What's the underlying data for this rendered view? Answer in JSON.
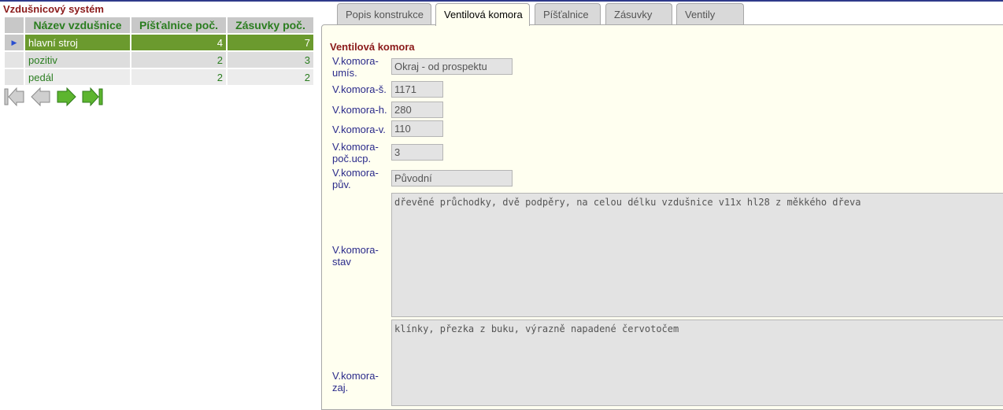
{
  "left": {
    "title": "Vzdušnicový systém",
    "columns": [
      "Název vzdušnice",
      "Píšťalnice poč.",
      "Zásuvky poč."
    ],
    "rows": [
      {
        "name": "hlavní stroj",
        "pist": "4",
        "zas": "7",
        "selected": true
      },
      {
        "name": "pozitiv",
        "pist": "2",
        "zas": "3"
      },
      {
        "name": "pedál",
        "pist": "2",
        "zas": "2"
      }
    ],
    "row_indicator": "▶"
  },
  "tabs": [
    {
      "label": "Popis konstrukce"
    },
    {
      "label": "Ventilová komora",
      "active": true
    },
    {
      "label": "Píšťalnice"
    },
    {
      "label": "Zásuvky"
    },
    {
      "label": "Ventily"
    }
  ],
  "detail": {
    "title": "Ventilová komora",
    "fields": {
      "umis": {
        "label": "V.komora-umís.",
        "value": "Okraj - od prospektu"
      },
      "s": {
        "label": "V.komora-š.",
        "value": "1171"
      },
      "h": {
        "label": "V.komora-h.",
        "value": "280"
      },
      "v": {
        "label": "V.komora-v.",
        "value": "110"
      },
      "pocucp": {
        "label": "V.komora-poč.ucp.",
        "value": "3"
      },
      "puv": {
        "label": "V.komora-pův.",
        "value": "Původní"
      },
      "stav": {
        "label": "V.komora-stav",
        "value": "dřevěné průchodky, dvě podpěry, na celou délku vzdušnice v11x hl28 z měkkého dřeva"
      },
      "zaj": {
        "label": "V.komora-zaj.",
        "value": "klínky, přezka z buku, výrazně napadené červotočem"
      }
    }
  },
  "icons": [
    "first-record-icon",
    "previous-record-icon",
    "next-record-icon",
    "last-record-icon"
  ],
  "colors": {
    "title": "#8b1a1a",
    "header_text": "#2a7d1f",
    "selected_row": "#6b9a2e",
    "panel_bg": "#fffff0",
    "label_text": "#2a2a8a"
  }
}
